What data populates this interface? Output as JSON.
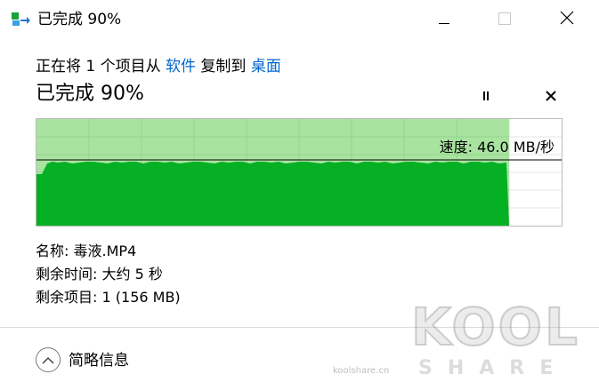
{
  "window": {
    "title": "已完成 90%"
  },
  "transfer": {
    "prefix": "正在将 1 个项目从 ",
    "source": "软件",
    "middle": " 复制到 ",
    "destination": "桌面"
  },
  "progress": {
    "heading": "已完成 90%",
    "percent": 90,
    "speed_label": "速度: 46.0 MB/秒",
    "fill_color": "#06b025",
    "remaining_color": "#a8e4a0"
  },
  "details": {
    "name_label": "名称:",
    "name_value": "毒液.MP4",
    "time_label": "剩余时间:",
    "time_value": "大约 5 秒",
    "items_label": "剩余项目:",
    "items_value": "1 (156 MB)"
  },
  "footer": {
    "more_label": "简略信息"
  },
  "watermark": {
    "brand": "KOOL",
    "tagline": "SHARE",
    "site": "koolshare.cn"
  }
}
